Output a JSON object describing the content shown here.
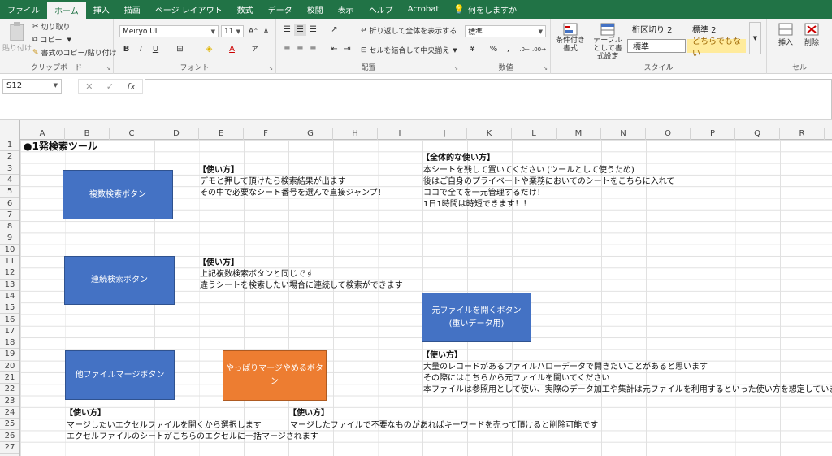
{
  "tabs": [
    "ファイル",
    "ホーム",
    "挿入",
    "描画",
    "ページ レイアウト",
    "数式",
    "データ",
    "校閲",
    "表示",
    "ヘルプ",
    "Acrobat",
    "何をしますか"
  ],
  "ribbon": {
    "clipboard": {
      "paste": "貼り付け",
      "cut": "切り取り",
      "copy": "コピー",
      "format_painter": "書式のコピー/貼り付け",
      "title": "クリップボード"
    },
    "font": {
      "name": "Meiryo UI",
      "size": "11",
      "bold": "B",
      "italic": "I",
      "underline": "U",
      "grow": "A",
      "shrink": "A",
      "font_color": "A",
      "title": "フォント"
    },
    "alignment": {
      "wrap": "折り返して全体を表示する",
      "merge": "セルを結合して中央揃え",
      "title": "配置"
    },
    "number": {
      "format": "標準",
      "percent": "%",
      "comma": ",",
      "title": "数値"
    },
    "styles": {
      "conditional": "条件付き書式",
      "table": "テーブルとして書式設定",
      "s1": "桁区切り 2",
      "s2": "標準 2",
      "s3": "標準",
      "s4": "どちらでもない",
      "title": "スタイル"
    },
    "cells": {
      "insert": "挿入",
      "delete": "削除",
      "title": "セル"
    }
  },
  "formula_bar": {
    "name_box": "S12",
    "cancel": "✕",
    "enter": "✓",
    "fx": "fx",
    "value": ""
  },
  "columns": [
    "A",
    "B",
    "C",
    "D",
    "E",
    "F",
    "G",
    "H",
    "I",
    "J",
    "K",
    "L",
    "M",
    "N",
    "O",
    "P",
    "Q",
    "R"
  ],
  "rows": [
    "1",
    "2",
    "3",
    "4",
    "5",
    "6",
    "7",
    "8",
    "9",
    "10",
    "11",
    "12",
    "13",
    "14",
    "15",
    "16",
    "17",
    "18",
    "19",
    "20",
    "21",
    "22",
    "23",
    "24",
    "25",
    "26",
    "27"
  ],
  "sheet": {
    "title": "●1発検索ツール",
    "buttons": {
      "multi_search": "複数検索ボタン",
      "continuous_search": "連続検索ボタン",
      "open_source": "元ファイルを開くボタン",
      "open_source_sub": "(重いデータ用)",
      "other_merge": "他ファイルマージボタン",
      "cancel_merge": "やっぱりマージやめるボタン"
    },
    "usage1": {
      "head": "【使い方】",
      "l1": "デモと押して頂けたら検索結果が出ます",
      "l2": "その中で必要なシート番号を選んで直接ジャンプ！"
    },
    "overall": {
      "head": "【全体的な使い方】",
      "l1": "本シートを残して置いてください (ツールとして使うため)",
      "l2": "後はご自身のプライベートや業務においてのシートをこちらに入れて",
      "l3": "ココで全てを一元管理するだけ！",
      "l4": "1日1時間は時短できます！！"
    },
    "usage2": {
      "head": "【使い方】",
      "l1": "上記複数検索ボタンと同じです",
      "l2": "違うシートを検索したい場合に連続して検索ができます"
    },
    "usage3": {
      "head": "【使い方】",
      "l1": "大量のレコードがあるファイルハローデータで開きたいことがあると思います",
      "l2": "その際にはこちらから元ファイルを開いてください",
      "l3": "本ファイルは参照用として使い、実際のデータ加工や集計は元ファイルを利用するといった使い方を想定しています"
    },
    "usage4": {
      "head": "【使い方】",
      "l1": "マージしたいエクセルファイルを開くから選択します",
      "l2": "エクセルファイルのシートがこちらのエクセルに一括マージされます"
    },
    "usage5": {
      "head": "【使い方】",
      "l1": "マージしたファイルで不要なものがあればキーワードを売って頂けると削除可能です"
    }
  }
}
